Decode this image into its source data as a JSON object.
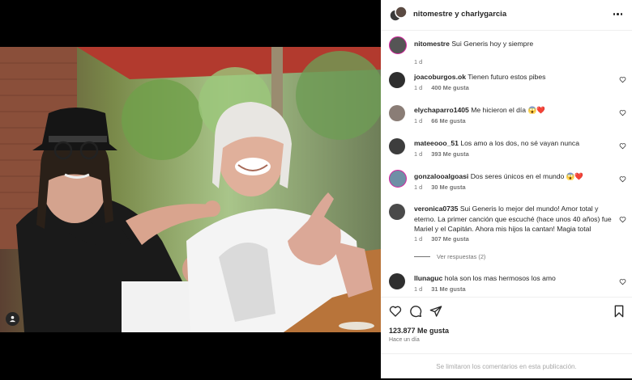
{
  "post": {
    "author": "nitomestre y charlygarcia",
    "icons": {
      "more": "more-horizontal-icon",
      "user": "user-tag-icon"
    }
  },
  "caption": {
    "user": "nitomestre",
    "text": "Sui Generis hoy y siempre",
    "time": "1 d"
  },
  "comments": [
    {
      "user": "joacoburgos.ok",
      "text": "Tienen futuro estos pibes",
      "time": "1 d",
      "likes": "400 Me gusta"
    },
    {
      "user": "elychaparro1405",
      "text": "Me hicieron el día 😱❤️",
      "time": "1 d",
      "likes": "66 Me gusta"
    },
    {
      "user": "mateeooo_51",
      "text": "Los amo a los dos, no sé vayan nunca",
      "time": "1 d",
      "likes": "393 Me gusta"
    },
    {
      "user": "gonzalooalgoasi",
      "text": "Dos seres únicos en el mundo 😱❤️",
      "time": "1 d",
      "likes": "30 Me gusta"
    },
    {
      "user": "veronica0735",
      "text": "Sui Generis lo mejor del mundo! Amor total y eterno. La primer canción que escuché (hace unos 40 años) fue Mariel y el Capitán. Ahora mis hijos la cantan! Magia total",
      "time": "1 d",
      "likes": "307 Me gusta"
    },
    {
      "user": "llunaguc",
      "text": "hola son los mas hermosos los amo",
      "time": "1 d",
      "likes": "31 Me gusta"
    }
  ],
  "view_replies": "Ver respuestas (2)",
  "actions": {
    "likes": "123.877 Me gusta",
    "time_ago": "Hace un día",
    "icons": [
      "heart-icon",
      "comment-icon",
      "share-icon",
      "bookmark-icon"
    ]
  },
  "limited_notice": "Se limitaron los comentarios en esta publicación.",
  "colors": {
    "text": "#262626",
    "secondary": "#737373",
    "border": "#efefef",
    "heart_red": "#ed4956"
  }
}
